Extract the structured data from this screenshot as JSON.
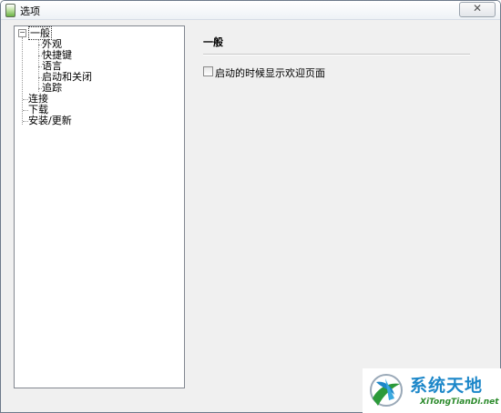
{
  "window": {
    "title": "选项",
    "close_glyph": "✕"
  },
  "tree": {
    "items": [
      {
        "label": "一般",
        "level": 0,
        "selected": true,
        "expanded": true
      },
      {
        "label": "外观",
        "level": 1
      },
      {
        "label": "快捷键",
        "level": 1
      },
      {
        "label": "语言",
        "level": 1
      },
      {
        "label": "启动和关闭",
        "level": 1
      },
      {
        "label": "追踪",
        "level": 1
      },
      {
        "label": "连接",
        "level": 0
      },
      {
        "label": "下载",
        "level": 0
      },
      {
        "label": "安装/更新",
        "level": 0
      }
    ],
    "expander_glyph": "−"
  },
  "content": {
    "section_title": "一般",
    "option_welcome": {
      "label": "启动的时候显示欢迎页面",
      "checked": false
    }
  },
  "watermark": {
    "title": "系统天地",
    "subtitle": "XiTongTianDi.net"
  },
  "icons": {
    "app": "options-icon",
    "close": "close-icon",
    "watermark_logo": "globe-logo-icon"
  }
}
